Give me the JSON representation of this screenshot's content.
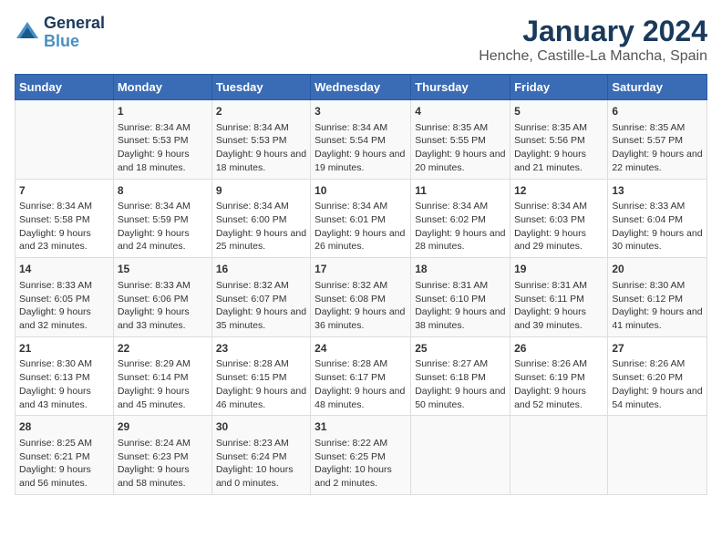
{
  "header": {
    "logo_line1": "General",
    "logo_line2": "Blue",
    "title": "January 2024",
    "subtitle": "Henche, Castille-La Mancha, Spain"
  },
  "days": [
    "Sunday",
    "Monday",
    "Tuesday",
    "Wednesday",
    "Thursday",
    "Friday",
    "Saturday"
  ],
  "weeks": [
    [
      {
        "date": "",
        "sunrise": "",
        "sunset": "",
        "daylight": ""
      },
      {
        "date": "1",
        "sunrise": "Sunrise: 8:34 AM",
        "sunset": "Sunset: 5:53 PM",
        "daylight": "Daylight: 9 hours and 18 minutes."
      },
      {
        "date": "2",
        "sunrise": "Sunrise: 8:34 AM",
        "sunset": "Sunset: 5:53 PM",
        "daylight": "Daylight: 9 hours and 18 minutes."
      },
      {
        "date": "3",
        "sunrise": "Sunrise: 8:34 AM",
        "sunset": "Sunset: 5:54 PM",
        "daylight": "Daylight: 9 hours and 19 minutes."
      },
      {
        "date": "4",
        "sunrise": "Sunrise: 8:35 AM",
        "sunset": "Sunset: 5:55 PM",
        "daylight": "Daylight: 9 hours and 20 minutes."
      },
      {
        "date": "5",
        "sunrise": "Sunrise: 8:35 AM",
        "sunset": "Sunset: 5:56 PM",
        "daylight": "Daylight: 9 hours and 21 minutes."
      },
      {
        "date": "6",
        "sunrise": "Sunrise: 8:35 AM",
        "sunset": "Sunset: 5:57 PM",
        "daylight": "Daylight: 9 hours and 22 minutes."
      }
    ],
    [
      {
        "date": "7",
        "sunrise": "Sunrise: 8:34 AM",
        "sunset": "Sunset: 5:58 PM",
        "daylight": "Daylight: 9 hours and 23 minutes."
      },
      {
        "date": "8",
        "sunrise": "Sunrise: 8:34 AM",
        "sunset": "Sunset: 5:59 PM",
        "daylight": "Daylight: 9 hours and 24 minutes."
      },
      {
        "date": "9",
        "sunrise": "Sunrise: 8:34 AM",
        "sunset": "Sunset: 6:00 PM",
        "daylight": "Daylight: 9 hours and 25 minutes."
      },
      {
        "date": "10",
        "sunrise": "Sunrise: 8:34 AM",
        "sunset": "Sunset: 6:01 PM",
        "daylight": "Daylight: 9 hours and 26 minutes."
      },
      {
        "date": "11",
        "sunrise": "Sunrise: 8:34 AM",
        "sunset": "Sunset: 6:02 PM",
        "daylight": "Daylight: 9 hours and 28 minutes."
      },
      {
        "date": "12",
        "sunrise": "Sunrise: 8:34 AM",
        "sunset": "Sunset: 6:03 PM",
        "daylight": "Daylight: 9 hours and 29 minutes."
      },
      {
        "date": "13",
        "sunrise": "Sunrise: 8:33 AM",
        "sunset": "Sunset: 6:04 PM",
        "daylight": "Daylight: 9 hours and 30 minutes."
      }
    ],
    [
      {
        "date": "14",
        "sunrise": "Sunrise: 8:33 AM",
        "sunset": "Sunset: 6:05 PM",
        "daylight": "Daylight: 9 hours and 32 minutes."
      },
      {
        "date": "15",
        "sunrise": "Sunrise: 8:33 AM",
        "sunset": "Sunset: 6:06 PM",
        "daylight": "Daylight: 9 hours and 33 minutes."
      },
      {
        "date": "16",
        "sunrise": "Sunrise: 8:32 AM",
        "sunset": "Sunset: 6:07 PM",
        "daylight": "Daylight: 9 hours and 35 minutes."
      },
      {
        "date": "17",
        "sunrise": "Sunrise: 8:32 AM",
        "sunset": "Sunset: 6:08 PM",
        "daylight": "Daylight: 9 hours and 36 minutes."
      },
      {
        "date": "18",
        "sunrise": "Sunrise: 8:31 AM",
        "sunset": "Sunset: 6:10 PM",
        "daylight": "Daylight: 9 hours and 38 minutes."
      },
      {
        "date": "19",
        "sunrise": "Sunrise: 8:31 AM",
        "sunset": "Sunset: 6:11 PM",
        "daylight": "Daylight: 9 hours and 39 minutes."
      },
      {
        "date": "20",
        "sunrise": "Sunrise: 8:30 AM",
        "sunset": "Sunset: 6:12 PM",
        "daylight": "Daylight: 9 hours and 41 minutes."
      }
    ],
    [
      {
        "date": "21",
        "sunrise": "Sunrise: 8:30 AM",
        "sunset": "Sunset: 6:13 PM",
        "daylight": "Daylight: 9 hours and 43 minutes."
      },
      {
        "date": "22",
        "sunrise": "Sunrise: 8:29 AM",
        "sunset": "Sunset: 6:14 PM",
        "daylight": "Daylight: 9 hours and 45 minutes."
      },
      {
        "date": "23",
        "sunrise": "Sunrise: 8:28 AM",
        "sunset": "Sunset: 6:15 PM",
        "daylight": "Daylight: 9 hours and 46 minutes."
      },
      {
        "date": "24",
        "sunrise": "Sunrise: 8:28 AM",
        "sunset": "Sunset: 6:17 PM",
        "daylight": "Daylight: 9 hours and 48 minutes."
      },
      {
        "date": "25",
        "sunrise": "Sunrise: 8:27 AM",
        "sunset": "Sunset: 6:18 PM",
        "daylight": "Daylight: 9 hours and 50 minutes."
      },
      {
        "date": "26",
        "sunrise": "Sunrise: 8:26 AM",
        "sunset": "Sunset: 6:19 PM",
        "daylight": "Daylight: 9 hours and 52 minutes."
      },
      {
        "date": "27",
        "sunrise": "Sunrise: 8:26 AM",
        "sunset": "Sunset: 6:20 PM",
        "daylight": "Daylight: 9 hours and 54 minutes."
      }
    ],
    [
      {
        "date": "28",
        "sunrise": "Sunrise: 8:25 AM",
        "sunset": "Sunset: 6:21 PM",
        "daylight": "Daylight: 9 hours and 56 minutes."
      },
      {
        "date": "29",
        "sunrise": "Sunrise: 8:24 AM",
        "sunset": "Sunset: 6:23 PM",
        "daylight": "Daylight: 9 hours and 58 minutes."
      },
      {
        "date": "30",
        "sunrise": "Sunrise: 8:23 AM",
        "sunset": "Sunset: 6:24 PM",
        "daylight": "Daylight: 10 hours and 0 minutes."
      },
      {
        "date": "31",
        "sunrise": "Sunrise: 8:22 AM",
        "sunset": "Sunset: 6:25 PM",
        "daylight": "Daylight: 10 hours and 2 minutes."
      },
      {
        "date": "",
        "sunrise": "",
        "sunset": "",
        "daylight": ""
      },
      {
        "date": "",
        "sunrise": "",
        "sunset": "",
        "daylight": ""
      },
      {
        "date": "",
        "sunrise": "",
        "sunset": "",
        "daylight": ""
      }
    ]
  ]
}
